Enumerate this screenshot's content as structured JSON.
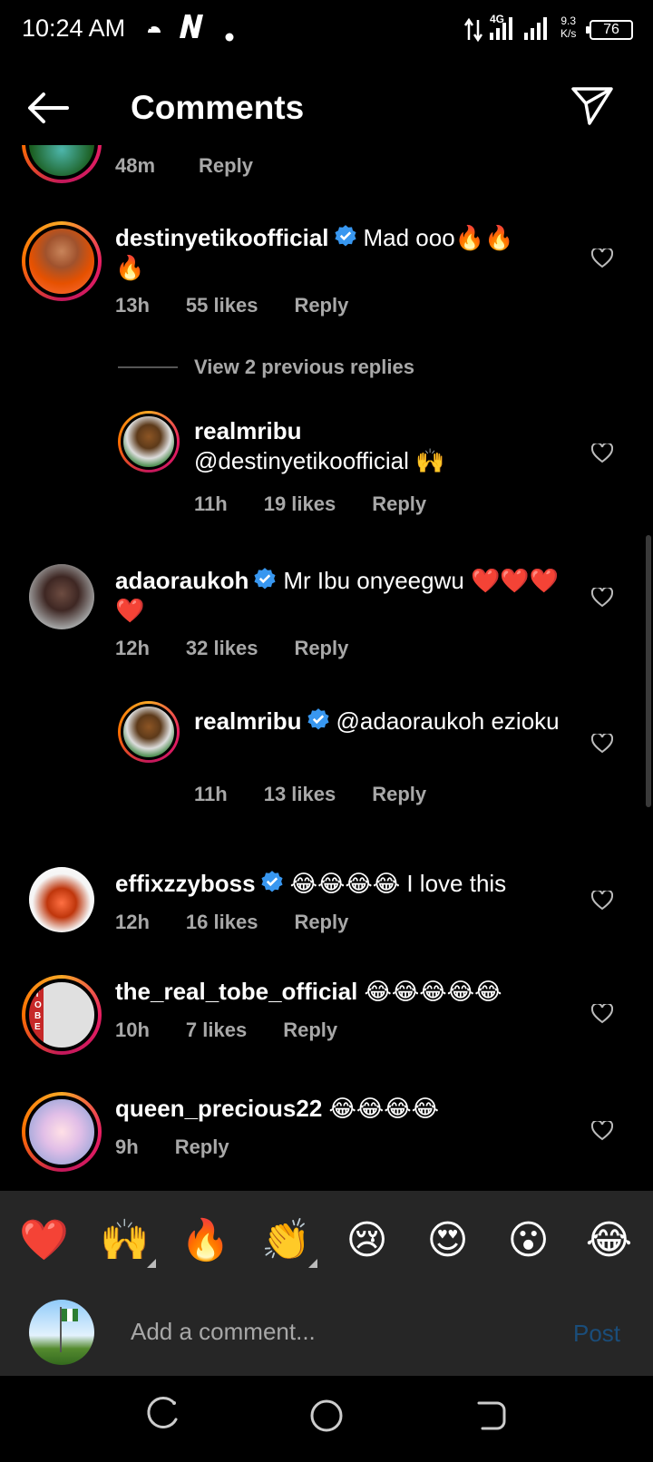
{
  "status_bar": {
    "time": "10:24 AM",
    "network": "4G",
    "speed_value": "9.3",
    "speed_unit": "K/s",
    "battery": "76"
  },
  "header": {
    "title": "Comments",
    "back_icon": "arrow-left-icon",
    "share_icon": "paper-plane-icon"
  },
  "comments": [
    {
      "time": "48m",
      "reply": "Reply"
    },
    {
      "user": "destinyetikoofficial",
      "verified": true,
      "text": "Mad ooo🔥🔥🔥",
      "time": "13h",
      "likes": "55 likes",
      "reply": "Reply"
    },
    {
      "view_replies": "View 2 previous replies"
    },
    {
      "user": "realmribu",
      "verified": false,
      "text": "@destinyetikoofficial 🙌",
      "time": "11h",
      "likes": "19 likes",
      "reply": "Reply"
    },
    {
      "user": "adaoraukoh",
      "verified": true,
      "text": "Mr Ibu onyeegwu ❤️❤️❤️❤️",
      "time": "12h",
      "likes": "32 likes",
      "reply": "Reply"
    },
    {
      "user": "realmribu",
      "verified": true,
      "text": "@adaoraukoh ezioku",
      "time": "11h",
      "likes": "13 likes",
      "reply": "Reply"
    },
    {
      "user": "effixzzyboss",
      "verified": true,
      "text": "😂😂😂😂 I love this",
      "time": "12h",
      "likes": "16 likes",
      "reply": "Reply"
    },
    {
      "user": "the_real_tobe_official",
      "verified": false,
      "text": "😂😂😂😂😂",
      "time": "10h",
      "likes": "7 likes",
      "reply": "Reply",
      "avatar_text": "TOBE"
    },
    {
      "user": "queen_precious22",
      "verified": false,
      "text": "😂😂😂😂",
      "time": "9h",
      "reply": "Reply"
    }
  ],
  "emoji_bar": [
    "❤️",
    "🙌",
    "🔥",
    "👏",
    "😢",
    "😍",
    "😮",
    "😂"
  ],
  "add_comment": {
    "placeholder": "Add a comment...",
    "post": "Post"
  },
  "colors": {
    "background": "#000000",
    "verified": "#3897f0",
    "muted": "#a8a8a8",
    "post_disabled": "#1a4d7a"
  }
}
